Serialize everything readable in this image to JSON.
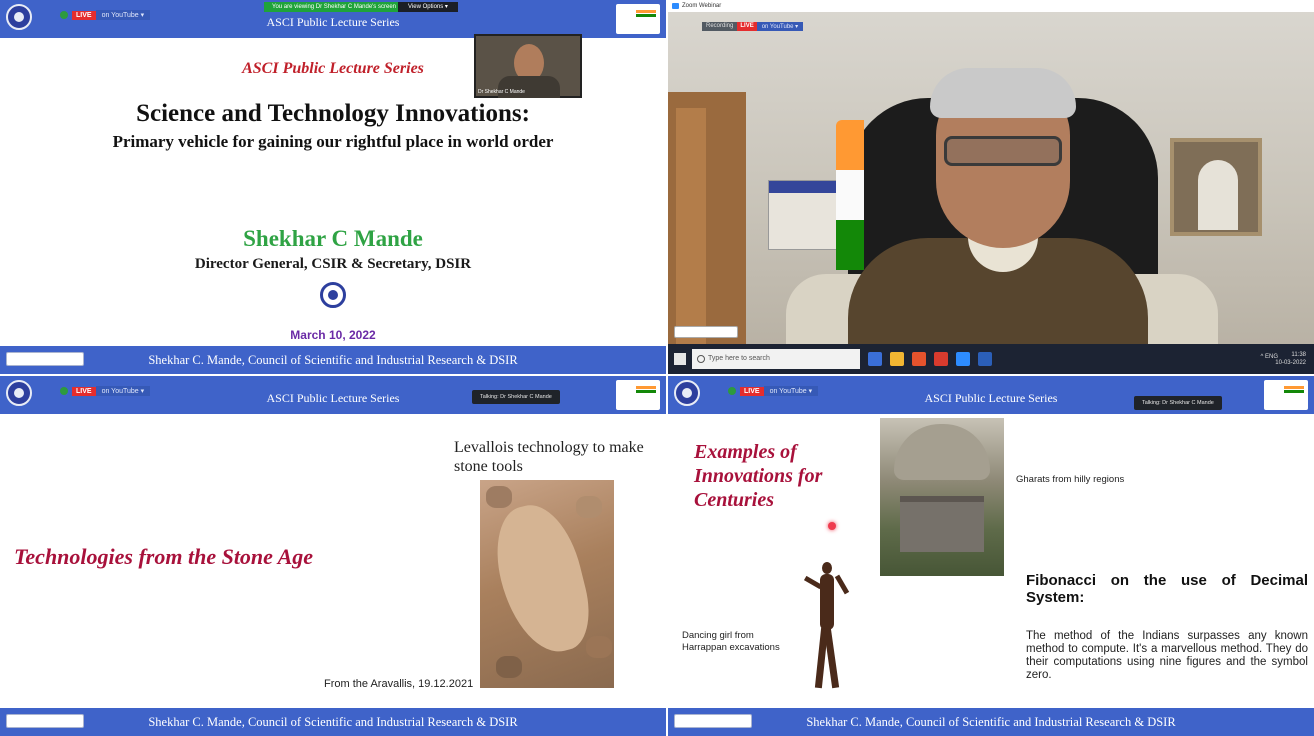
{
  "common": {
    "series_label": "ASCI Public Lecture Series",
    "footer": "Shekhar C. Mande, Council of Scientific and Industrial Research & DSIR",
    "live_badge": "LIVE",
    "youtube_label": "on YouTube ▾",
    "colors": {
      "bar_blue": "#3f63c9",
      "accent_red": "#a8113b",
      "speaker_green": "#2fa344",
      "date_purple": "#6a2aa6"
    }
  },
  "panel1": {
    "viewing_banner": "You are viewing Dr Shekhar C Mande's screen",
    "view_options": "View Options ▾",
    "series_heading": "ASCI Public Lecture Series",
    "title": "Science and Technology Innovations:",
    "subtitle": "Primary vehicle for gaining our rightful place in world order",
    "speaker": "Shekhar C Mande",
    "role": "Director General, CSIR & Secretary, DSIR",
    "date": "March 10, 2022",
    "video_label": "Dr Shekhar C Mande"
  },
  "panel2": {
    "window_title": "Zoom Webinar",
    "recording_label": "Recording",
    "search_placeholder": "Type here to search",
    "clock_time": "11:38",
    "clock_date": "10-03-2022",
    "tray_text": "^ ENG"
  },
  "panel3": {
    "talking": "Talking: Dr Shekhar C Mande",
    "heading": "Technologies from the Stone Age",
    "photo_caption": "Levallois technology to make stone tools",
    "photo_credit": "From the Aravallis, 19.12.2021"
  },
  "panel4": {
    "talking": "Talking: Dr Shekhar C Mande",
    "heading_line1": "Examples of",
    "heading_line2": "Innovations for",
    "heading_line3": "Centuries",
    "gharat_caption": "Gharats from hilly regions",
    "fibonacci_title": "Fibonacci on the use of Decimal System:",
    "fibonacci_quote": "The method of the Indians surpasses any known method to compute. It's a marvellous method. They do their computations using nine figures and the symbol zero.",
    "dancing_caption": "Dancing girl from Harrappan excavations"
  }
}
